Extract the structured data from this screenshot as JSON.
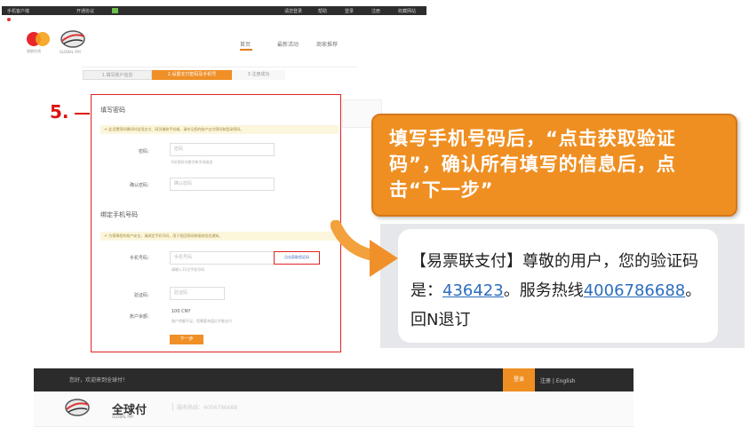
{
  "topbar": {
    "items": [
      "手机客户端",
      "开通协议",
      "请您登录",
      "帮助",
      "登录",
      "注册",
      "收藏网站"
    ]
  },
  "logos": {
    "mastercard_caption": "银联在线",
    "globalpay_caption": "GLOBAL PAY"
  },
  "nav": {
    "items": [
      "首页",
      "最新活动",
      "商家推荐"
    ]
  },
  "steps": [
    "1.填写账户信息",
    "2.设置支付密码及手机号",
    "3.注册成功"
  ],
  "form": {
    "section1_title": "填写密码",
    "notice1": "＊ 此设置密码需同时适用支付、网页端和手机端，请牢记您的账户支付密码和登录密码。",
    "password_label": "密码：",
    "password_placeholder": "密码",
    "password_hint": "6位密码为数字和字母组合",
    "confirm_label": "确认密码：",
    "confirm_placeholder": "确认密码",
    "section2_title": "绑定手机号码",
    "notice2": "＊ 为保障您的账户安全，请绑定手机号码，用于找回密码和接收短信通知。",
    "phone_label": "手机号码：",
    "phone_placeholder": "手机号码",
    "phone_hint": "请输入11位手机号码",
    "get_code_label": "点击获取验证码",
    "code_label": "验证码：",
    "code_placeholder": "验证码",
    "balance_label": "账户余额：",
    "balance_value": "100 CNY",
    "balance_hint": "账户余额不足，您需要充值后才能支付",
    "next_label": "下一步"
  },
  "annotation": {
    "step_number": "5."
  },
  "callout": {
    "text": "填写手机号码后，“点击获取验证码”，确认所有填写的信息后，点击“下一步”"
  },
  "sms": {
    "prefix": "【易票联支付】尊敬的用户，您的验证码是：",
    "code": "436423",
    "middle": "。服务热线",
    "hotline": "4006786688",
    "suffix": "。回N退订"
  },
  "footer": {
    "greeting": "您好，欢迎来到全球付！",
    "orange_label": "登录",
    "links": "注册 | English",
    "brand": "全球付",
    "brand_sub": "GLOBAL PAY",
    "hotline": "服务热线：4006786688"
  },
  "colors": {
    "accent_orange": "#ef8f22",
    "highlight_red": "#e02424",
    "link_blue": "#2c6dbd"
  }
}
